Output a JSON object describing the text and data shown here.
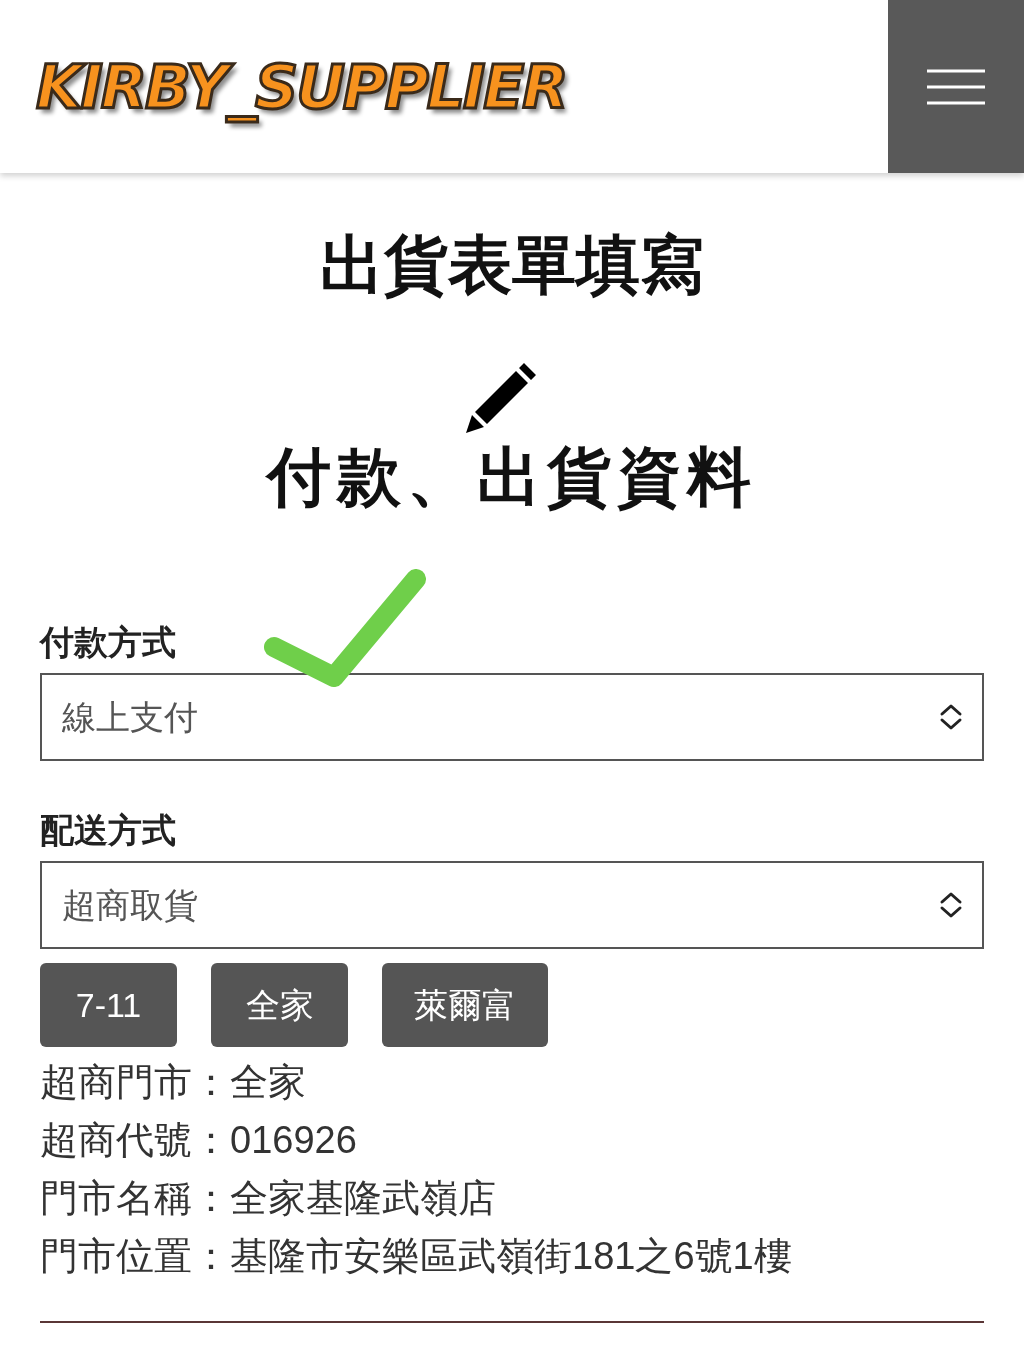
{
  "header": {
    "logo": "KIRBY_SUPPLIER"
  },
  "page_title": "出貨表單填寫",
  "section_title": "付款、出貨資料",
  "fields": [
    {
      "label": "付款方式",
      "value": "線上支付"
    },
    {
      "label": "配送方式",
      "value": "超商取貨"
    }
  ],
  "store_buttons": [
    "7-11",
    "全家",
    "萊爾富"
  ],
  "store_info": [
    "超商門市：全家",
    "超商代號：016926",
    "門市名稱：全家基隆武嶺店",
    "門市位置：基隆市安樂區武嶺街181之6號1樓"
  ]
}
